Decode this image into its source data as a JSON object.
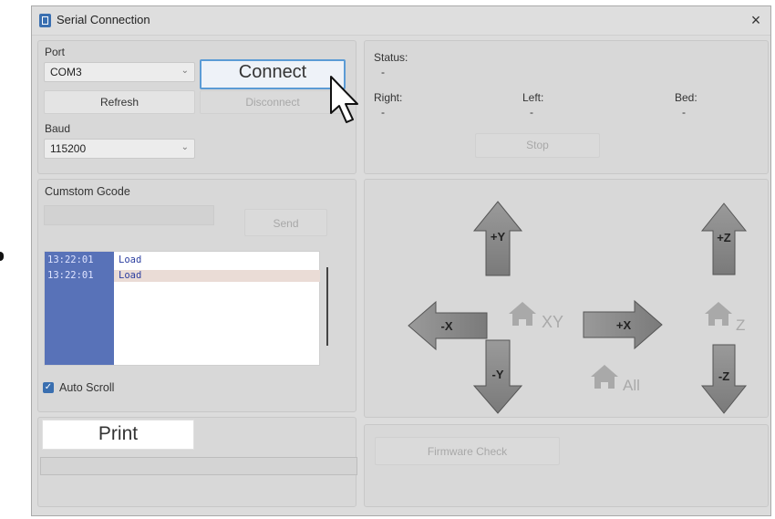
{
  "window": {
    "title": "Serial Connection",
    "close": "×"
  },
  "port": {
    "label": "Port",
    "selected": "COM3",
    "connect_label": "Connect",
    "refresh_label": "Refresh",
    "disconnect_label": "Disconnect",
    "baud_label": "Baud",
    "baud_selected": "115200"
  },
  "status": {
    "label": "Status:",
    "value": "-",
    "right_label": "Right:",
    "right_value": "-",
    "left_label": "Left:",
    "left_value": "-",
    "bed_label": "Bed:",
    "bed_value": "-",
    "stop_label": "Stop"
  },
  "gcode": {
    "label": "Cumstom Gcode",
    "input_value": "",
    "send_label": "Send",
    "log": [
      {
        "time": "13:22:01",
        "msg": "Load"
      },
      {
        "time": "13:22:01",
        "msg": "Load"
      }
    ],
    "autoscroll_label": "Auto Scroll",
    "autoscroll_checked": true
  },
  "jog": {
    "plus_y": "+Y",
    "minus_y": "-Y",
    "plus_x": "+X",
    "minus_x": "-X",
    "plus_z": "+Z",
    "minus_z": "-Z",
    "home_xy": "XY",
    "home_z": "Z",
    "home_all": "All"
  },
  "print": {
    "label": "Print",
    "progress": 0
  },
  "firmware": {
    "check_label": "Firmware Check"
  },
  "colors": {
    "accent": "#5b9bd5",
    "log_time_bg": "#5872b8",
    "window_bg": "#dcdcdc"
  }
}
